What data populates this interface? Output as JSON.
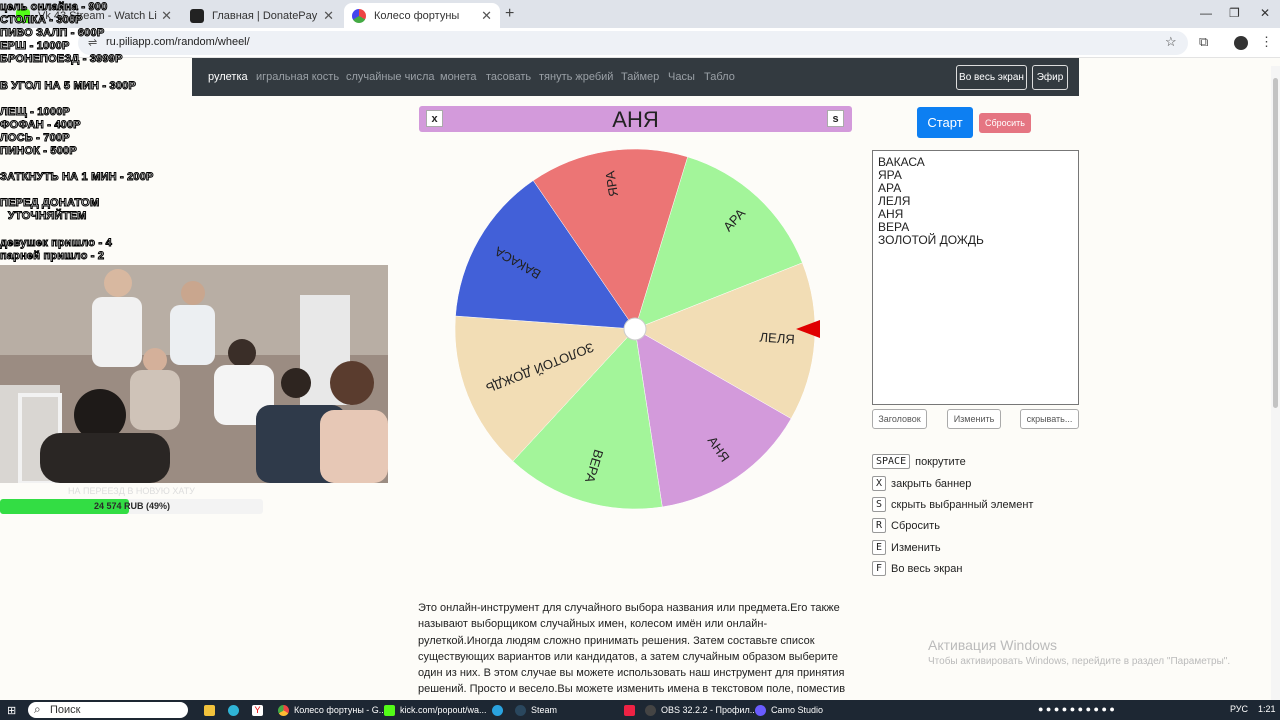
{
  "browser": {
    "tabs": [
      {
        "title": "Vk 43 Stream - Watch Li"
      },
      {
        "title": "Главная | DonatePay"
      },
      {
        "title": "Колесо фортуны"
      }
    ],
    "url": "ru.piliapp.com/random/wheel/"
  },
  "nav": {
    "links": [
      "рулетка",
      "игральная кость",
      "случайные числа",
      "монета",
      "тасовать",
      "тянуть жребий",
      "Таймер",
      "Часы",
      "Табло"
    ],
    "fullscreen": "Во весь экран",
    "broadcast": "Эфир"
  },
  "banner": {
    "close_key": "x",
    "name": "АНЯ",
    "hide_key": "s"
  },
  "wheel": {
    "segments": [
      {
        "label": "АРА",
        "color": "#a3f59a"
      },
      {
        "label": "ЛЕЛЯ",
        "color": "#f2ddb5"
      },
      {
        "label": "АНЯ",
        "color": "#d39adb"
      },
      {
        "label": "ВЕРА",
        "color": "#a3f59a"
      },
      {
        "label": "ЗОЛОТОЙ ДОЖДЬ",
        "color": "#f2ddb5"
      },
      {
        "label": "ВАКАСА",
        "color": "#4260d8"
      },
      {
        "label": "ЯРА",
        "color": "#ec7575"
      }
    ],
    "pointer_color": "#e00000"
  },
  "controls": {
    "start": "Старт",
    "reset": "Сбросить"
  },
  "names": [
    "ВАКАСА",
    "ЯРА",
    "АРА",
    "ЛЕЛЯ",
    "АНЯ",
    "ВЕРА",
    "ЗОЛОТОЙ ДОЖДЬ"
  ],
  "buttons": {
    "title": "Заголовок",
    "edit": "Изменить",
    "hide": "скрывать..."
  },
  "hotkeys": [
    {
      "key": "SPACE",
      "text": "покрутите"
    },
    {
      "key": "X",
      "text": "закрыть баннер"
    },
    {
      "key": "S",
      "text": "скрыть выбранный элемент"
    },
    {
      "key": "R",
      "text": "Сбросить"
    },
    {
      "key": "E",
      "text": "Изменить"
    },
    {
      "key": "F",
      "text": "Во весь экран"
    }
  ],
  "description": "Это онлайн-инструмент для случайного выбора названия или предмета.Его также называют выборщиком случайных имен, колесом имён или онлайн-рулеткой.Иногда людям сложно принимать решения. Затем составьте список существующих вариантов или кандидатов, а затем случайным образом выберите один из них. В этом случае вы можете использовать наш инструмент для принятия решений. Просто и весело.Вы можете изменить имена в текстовом поле, поместив одно имя в строку.Имена будут",
  "activation": {
    "title": "Активация Windows",
    "subtitle": "Чтобы активировать Windows, перейдите в раздел \"Параметры\"."
  },
  "overlay": {
    "lines": [
      "цель онлайна - 900",
      "СТОЛКА - 300Р",
      "ПИВО ЗАЛП - 600Р",
      "ЕРШ - 1000Р",
      "БРОНЕПОЕЗД - 3999Р",
      "В УГОЛ НА 5 МИН - 300Р",
      "ЛЕЩ - 1000Р",
      "ФОФАН - 400Р",
      "ЛОСЬ - 700Р",
      "ПИНОК - 500Р",
      "ЗАТКНУТЬ НА 1 МИН - 200Р",
      "ПЕРЕД ДОНАТОМ",
      "УТОЧНЯЙТЕМ",
      "девушек пришло - 4",
      "парней пришло - 2"
    ],
    "goal_text": "НА ПЕРЕЕЗД В НОВУЮ ХАТУ",
    "goal_label": "24 574 RUB (49%)",
    "goal_percent": 49
  },
  "taskbar": {
    "search": "Поиск",
    "items": [
      "Колесо фортуны - G...",
      "kick.com/popout/wa...",
      "Steam",
      "OBS 32.2.2 - Профил...",
      "Camo Studio"
    ],
    "lang": "РУС",
    "time": "1:21"
  }
}
